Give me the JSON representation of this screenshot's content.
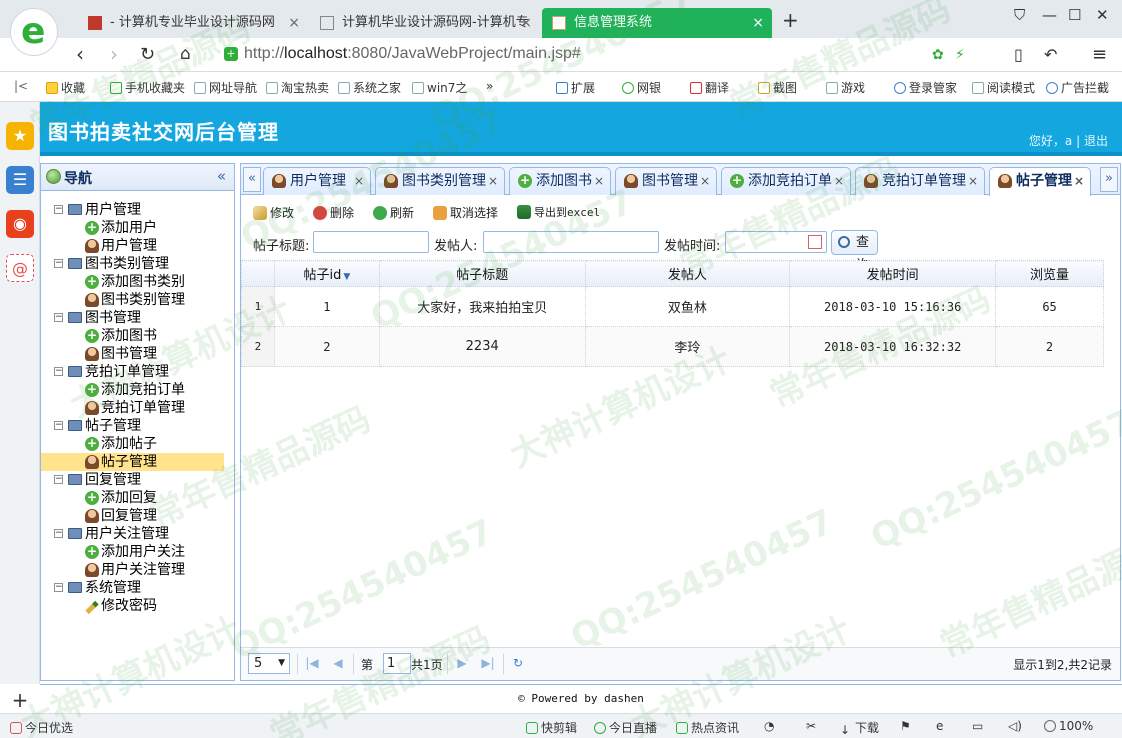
{
  "browser": {
    "tabs": [
      {
        "label": "- 计算机专业毕业设计源码网",
        "active": false
      },
      {
        "label": "计算机毕业设计源码网-计算机专",
        "active": false
      },
      {
        "label": "信息管理系统",
        "active": true
      }
    ],
    "new_tab_label": "+",
    "url_prefix": "http://",
    "url_host": "localhost",
    "url_rest": ":8080/JavaWebProject/main.jsp#",
    "favorites": [
      {
        "label": "收藏",
        "icon": "star-icon"
      },
      {
        "label": "手机收藏夹",
        "icon": "phone-icon"
      },
      {
        "label": "网址导航",
        "icon": "page-icon"
      },
      {
        "label": "淘宝热卖",
        "icon": "page-icon"
      },
      {
        "label": "系统之家",
        "icon": "page-icon"
      },
      {
        "label": "win7之",
        "icon": "page-icon"
      }
    ],
    "tools": [
      {
        "label": "扩展",
        "icon": "grid-icon"
      },
      {
        "label": "网银",
        "icon": "bank-icon"
      },
      {
        "label": "翻译",
        "icon": "translate-icon"
      },
      {
        "label": "截图",
        "icon": "scissors-icon"
      },
      {
        "label": "游戏",
        "icon": "gamepad-icon"
      },
      {
        "label": "登录管家",
        "icon": "key-icon"
      },
      {
        "label": "阅读模式",
        "icon": "book-icon"
      },
      {
        "label": "广告拦截",
        "icon": "block-icon"
      }
    ],
    "more_glyph": "»",
    "status": {
      "left": "今日优选",
      "items": [
        {
          "label": "快剪辑",
          "icon": "scissors-icon"
        },
        {
          "label": "今日直播",
          "icon": "play-icon"
        },
        {
          "label": "热点资讯",
          "icon": "news-icon"
        },
        {
          "label": "下载",
          "icon": "download-icon"
        },
        {
          "label": "100%",
          "icon": "zoom-icon"
        }
      ]
    }
  },
  "app": {
    "title": "图书拍卖社交网后台管理",
    "greeting": "您好，a",
    "divider": "|",
    "logout": "退出",
    "nav": {
      "title": "导航",
      "collapse_glyph": "«",
      "groups": [
        {
          "label": "用户管理",
          "children": [
            {
              "label": "添加用户",
              "icon": "add"
            },
            {
              "label": "用户管理",
              "icon": "user"
            }
          ]
        },
        {
          "label": "图书类别管理",
          "children": [
            {
              "label": "添加图书类别",
              "icon": "add"
            },
            {
              "label": "图书类别管理",
              "icon": "user"
            }
          ]
        },
        {
          "label": "图书管理",
          "children": [
            {
              "label": "添加图书",
              "icon": "add"
            },
            {
              "label": "图书管理",
              "icon": "user"
            }
          ]
        },
        {
          "label": "竞拍订单管理",
          "children": [
            {
              "label": "添加竞拍订单",
              "icon": "add"
            },
            {
              "label": "竞拍订单管理",
              "icon": "user"
            }
          ]
        },
        {
          "label": "帖子管理",
          "children": [
            {
              "label": "添加帖子",
              "icon": "add"
            },
            {
              "label": "帖子管理",
              "icon": "user",
              "selected": true
            }
          ]
        },
        {
          "label": "回复管理",
          "children": [
            {
              "label": "添加回复",
              "icon": "add"
            },
            {
              "label": "回复管理",
              "icon": "user"
            }
          ]
        },
        {
          "label": "用户关注管理",
          "children": [
            {
              "label": "添加用户关注",
              "icon": "add"
            },
            {
              "label": "用户关注管理",
              "icon": "user"
            }
          ]
        },
        {
          "label": "系统管理",
          "children": [
            {
              "label": "修改密码",
              "icon": "pencil"
            }
          ]
        }
      ]
    },
    "tabs": [
      {
        "label": "用户管理",
        "icon": "user",
        "active": false
      },
      {
        "label": "图书类别管理",
        "icon": "user",
        "active": false
      },
      {
        "label": "添加图书",
        "icon": "add",
        "active": false
      },
      {
        "label": "图书管理",
        "icon": "user",
        "active": false
      },
      {
        "label": "添加竞拍订单",
        "icon": "add",
        "active": false
      },
      {
        "label": "竞拍订单管理",
        "icon": "user",
        "active": false
      },
      {
        "label": "帖子管理",
        "icon": "user",
        "active": true
      }
    ],
    "tab_close_glyph": "×",
    "tab_scroll_left": "«",
    "tab_scroll_right": "»",
    "toolbar": {
      "edit": "修改",
      "delete": "删除",
      "refresh": "刷新",
      "unselect": "取消选择",
      "export": "导出到excel"
    },
    "search": {
      "title_label": "帖子标题:",
      "title_value": "",
      "poster_label": "发帖人:",
      "poster_value": "",
      "time_label": "发帖时间:",
      "time_value": "",
      "query_button": "查询"
    },
    "grid": {
      "columns": [
        "帖子id",
        "帖子标题",
        "发帖人",
        "发帖时间",
        "浏览量"
      ],
      "sort_glyph": "▼",
      "rows": [
        {
          "no": "1",
          "id": "1",
          "title": "大家好，我来拍拍宝贝",
          "poster": "双鱼林",
          "time": "2018-03-10 15:16:36",
          "views": "65"
        },
        {
          "no": "2",
          "id": "2",
          "title": "2234",
          "poster": "李玲",
          "time": "2018-03-10 16:32:32",
          "views": "2"
        }
      ]
    },
    "pager": {
      "page_size": "5",
      "page_label": "第",
      "current_page": "1",
      "total_pages": "共1页",
      "info": "显示1到2,共2记录"
    },
    "footer": "© Powered by dashen"
  },
  "watermarks": [
    "QQ:254540457",
    "常年售精品源码",
    "大神计算机设计"
  ],
  "colors": {
    "header": "#14a6de",
    "accent": "#20b25b",
    "border": "#95b8e7",
    "selected": "#ffe48d"
  }
}
